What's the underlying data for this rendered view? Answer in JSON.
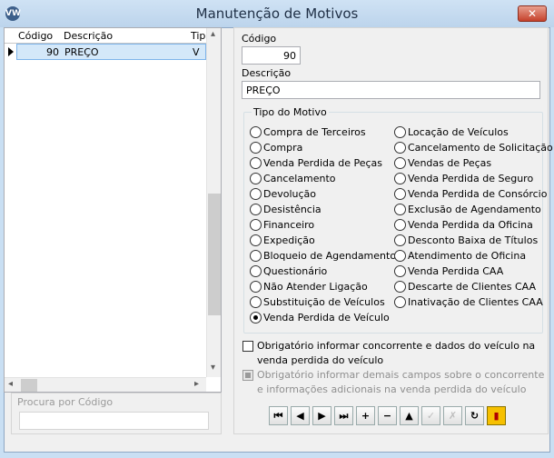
{
  "window": {
    "title": "Manutenção de Motivos",
    "app_icon": "vw-logo-icon",
    "close_label": "✕"
  },
  "grid": {
    "columns": [
      "Código",
      "Descrição",
      "Tip"
    ],
    "rows": [
      {
        "codigo": "90",
        "descricao": "PREÇO",
        "tipo": "V"
      }
    ],
    "scroll_up": "▴",
    "scroll_down": "▾",
    "scroll_left": "◂",
    "scroll_right": "▸"
  },
  "search": {
    "label": "Procura por Código",
    "value": ""
  },
  "form": {
    "codigo_label": "Código",
    "codigo_value": "90",
    "descricao_label": "Descrição",
    "descricao_value": "PREÇO",
    "tipo_group_title": "Tipo do Motivo",
    "tipos_col1": [
      {
        "label": "Compra de Terceiros",
        "checked": false
      },
      {
        "label": "Compra",
        "checked": false
      },
      {
        "label": "Venda Perdida de Peças",
        "checked": false
      },
      {
        "label": "Cancelamento",
        "checked": false
      },
      {
        "label": "Devolução",
        "checked": false
      },
      {
        "label": "Desistência",
        "checked": false
      },
      {
        "label": "Financeiro",
        "checked": false
      },
      {
        "label": "Expedição",
        "checked": false
      },
      {
        "label": "Bloqueio de Agendamento",
        "checked": false
      },
      {
        "label": "Questionário",
        "checked": false
      },
      {
        "label": "Não Atender Ligação",
        "checked": false
      },
      {
        "label": "Substituição de Veículos",
        "checked": false
      },
      {
        "label": "Venda Perdida de Veículo",
        "checked": true
      }
    ],
    "tipos_col2": [
      {
        "label": "Locação de Veículos",
        "checked": false
      },
      {
        "label": "Cancelamento de Solicitação",
        "checked": false
      },
      {
        "label": "Vendas de Peças",
        "checked": false
      },
      {
        "label": "Venda Perdida de Seguro",
        "checked": false
      },
      {
        "label": "Venda Perdida de Consórcio",
        "checked": false
      },
      {
        "label": "Exclusão de Agendamento",
        "checked": false
      },
      {
        "label": "Venda Perdida da Oficina",
        "checked": false
      },
      {
        "label": "Desconto Baixa de Títulos",
        "checked": false
      },
      {
        "label": "Atendimento de Oficina",
        "checked": false
      },
      {
        "label": "Venda Perdida CAA",
        "checked": false
      },
      {
        "label": "Descarte de Clientes CAA",
        "checked": false
      },
      {
        "label": "Inativação de Clientes CAA",
        "checked": false
      }
    ],
    "check1_label": "Obrigatório informar concorrente e dados do veículo na venda perdida do veículo",
    "check1_checked": false,
    "check2_label": "Obrigatório informar demais campos sobre o concorrente e informações adicionais na venda perdida do veículo",
    "check2_enabled": false
  },
  "toolbar": [
    {
      "name": "first-record-button",
      "icon": "first-icon",
      "glyph": "⏮",
      "enabled": true
    },
    {
      "name": "prev-record-button",
      "icon": "prev-icon",
      "glyph": "◀",
      "enabled": true
    },
    {
      "name": "next-record-button",
      "icon": "next-icon",
      "glyph": "▶",
      "enabled": true
    },
    {
      "name": "last-record-button",
      "icon": "last-icon",
      "glyph": "⏭",
      "enabled": true
    },
    {
      "name": "insert-button",
      "icon": "plus-icon",
      "glyph": "+",
      "enabled": true
    },
    {
      "name": "delete-button",
      "icon": "minus-icon",
      "glyph": "−",
      "enabled": true
    },
    {
      "name": "edit-button",
      "icon": "up-triangle-icon",
      "glyph": "▲",
      "enabled": true
    },
    {
      "name": "post-button",
      "icon": "check-icon",
      "glyph": "✓",
      "enabled": false
    },
    {
      "name": "cancel-edit-button",
      "icon": "cancel-icon",
      "glyph": "✗",
      "enabled": false
    },
    {
      "name": "refresh-button",
      "icon": "refresh-icon",
      "glyph": "↻",
      "enabled": true
    },
    {
      "name": "exit-button",
      "icon": "exit-door-icon",
      "glyph": "▮",
      "enabled": true
    }
  ]
}
